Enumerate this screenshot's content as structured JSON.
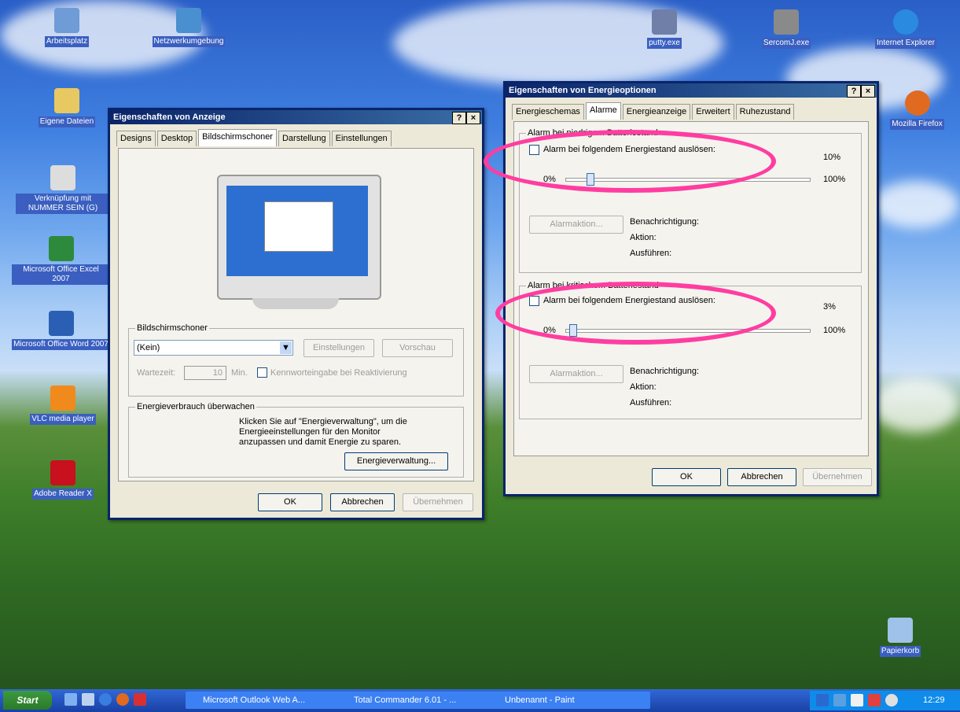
{
  "desktop_icons": [
    {
      "label": "Arbeitsplatz"
    },
    {
      "label": "Netzwerkumgebung"
    },
    {
      "label": "Eigene Dateien"
    },
    {
      "label": "Verknüpfung mit NUMMER SEIN (G)"
    },
    {
      "label": "Microsoft Office Excel 2007"
    },
    {
      "label": "Microsoft Office Word 2007"
    },
    {
      "label": "VLC media player"
    },
    {
      "label": "Adobe Reader X"
    },
    {
      "label": "putty.exe"
    },
    {
      "label": "SercomJ.exe"
    },
    {
      "label": "Internet Explorer"
    },
    {
      "label": "Mozilla Firefox"
    },
    {
      "label": "Papierkorb"
    }
  ],
  "display_dialog": {
    "title": "Eigenschaften von Anzeige",
    "help": "?",
    "close": "×",
    "tabs": [
      "Designs",
      "Desktop",
      "Bildschirmschoner",
      "Darstellung",
      "Einstellungen"
    ],
    "screensaver_group": "Bildschirmschoner",
    "screensaver_value": "(Kein)",
    "settings_btn": "Einstellungen",
    "preview_btn": "Vorschau",
    "wait_label": "Wartezeit:",
    "wait_value": "10",
    "min_label": "Min.",
    "password_label": "Kennworteingabe bei Reaktivierung",
    "energy_group": "Energieverbrauch überwachen",
    "energy_text_1": "Klicken Sie auf \"Energieverwaltung\", um die",
    "energy_text_2": "Energieeinstellungen für den Monitor",
    "energy_text_3": "anzupassen und damit Energie zu sparen.",
    "energy_btn": "Energieverwaltung...",
    "ok": "OK",
    "cancel": "Abbrechen",
    "apply": "Übernehmen"
  },
  "power_dialog": {
    "title": "Eigenschaften von Energieoptionen",
    "help": "?",
    "close": "×",
    "tabs": [
      "Energieschemas",
      "Alarme",
      "Energieanzeige",
      "Erweitert",
      "Ruhezustand"
    ],
    "low_group": "Alarm bei niedrigem Batteriestand",
    "low_check": "Alarm bei folgendem Energiestand auslösen:",
    "low_value": "10%",
    "low_min": "0%",
    "low_max": "100%",
    "low_level": 0.1,
    "low_action_btn": "Alarmaktion...",
    "low_notify": "Benachrichtigung:",
    "low_action": "Aktion:",
    "low_run": "Ausführen:",
    "crit_group": "Alarm bei kritischem Batteriestand",
    "crit_check": "Alarm bei folgendem Energiestand auslösen:",
    "crit_value": "3%",
    "crit_min": "0%",
    "crit_max": "100%",
    "crit_level": 0.03,
    "crit_action_btn": "Alarmaktion...",
    "crit_notify": "Benachrichtigung:",
    "crit_action": "Aktion:",
    "crit_run": "Ausführen:",
    "ok": "OK",
    "cancel": "Abbrechen",
    "apply": "Übernehmen"
  },
  "taskbar": {
    "start": "Start",
    "items": [
      "Microsoft Outlook Web A...",
      "Total Commander 6.01 - ...",
      "Unbenannt - Paint"
    ],
    "clock": "12:29"
  },
  "colors": {
    "highlight": "#ff3da0",
    "title_bar": "#0a246a",
    "taskbar": "#1941a5"
  }
}
